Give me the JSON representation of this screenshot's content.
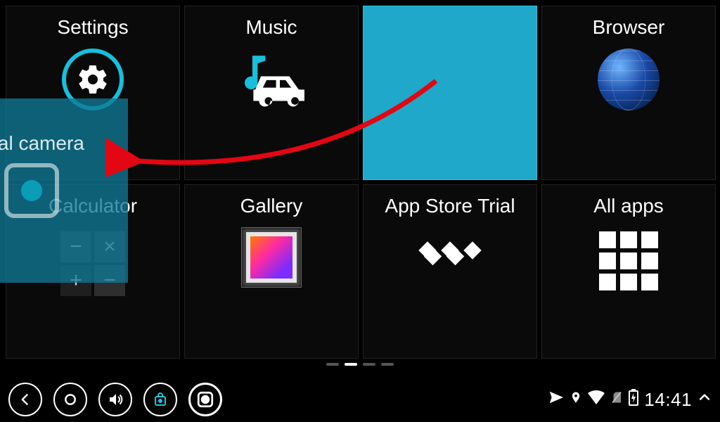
{
  "tiles": {
    "settings": {
      "label": "Settings"
    },
    "music": {
      "label": "Music"
    },
    "blank": {
      "label": ""
    },
    "browser": {
      "label": "Browser"
    },
    "calculator": {
      "label": "Calculator"
    },
    "gallery": {
      "label": "Gallery"
    },
    "appstore": {
      "label": "App Store Trial"
    },
    "allapps": {
      "label": "All apps"
    }
  },
  "drag": {
    "label": "rnal camera"
  },
  "pager": {
    "count": 4,
    "active_index": 1
  },
  "statusbar": {
    "time": "14:41"
  }
}
